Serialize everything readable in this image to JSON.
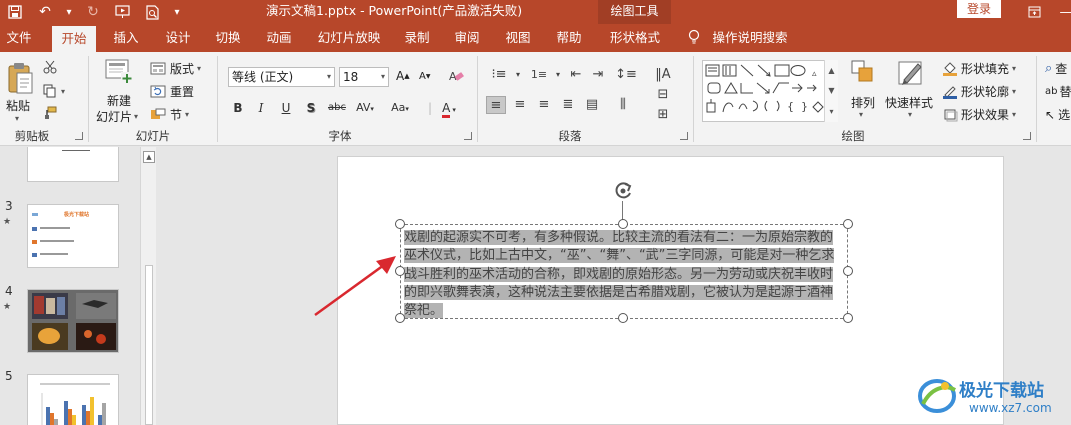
{
  "title_bar": {
    "doc_title": "演示文稿1.pptx  -  PowerPoint(产品激活失败)",
    "context_group": "绘图工具",
    "login": "登录"
  },
  "tabs": [
    "文件",
    "开始",
    "插入",
    "设计",
    "切换",
    "动画",
    "幻灯片放映",
    "录制",
    "审阅",
    "视图",
    "帮助",
    "形状格式",
    "操作说明搜索"
  ],
  "active_tab": "开始",
  "ribbon": {
    "clipboard": {
      "paste": "粘贴",
      "label": "剪贴板"
    },
    "slides": {
      "new_slide": "新建\n幻灯片",
      "layout": "版式",
      "reset": "重置",
      "section": "节",
      "label": "幻灯片"
    },
    "font": {
      "font_name": "等线 (正文)",
      "font_size": "18",
      "label": "字体"
    },
    "paragraph": {
      "label": "段落"
    },
    "drawing": {
      "arrange": "排列",
      "quick_styles": "快速样式",
      "shape_fill": "形状填充",
      "shape_outline": "形状轮廓",
      "shape_effects": "形状效果",
      "label": "绘图"
    },
    "editing": {
      "find": "查",
      "replace": "替",
      "select": "选"
    }
  },
  "slides_pane": {
    "slide_numbers": [
      "3",
      "4",
      "5"
    ],
    "slide3_title": "极光下载站"
  },
  "textbox": {
    "text": "戏剧的起源实不可考，有多种假说。比较主流的看法有二：一为原始宗教的巫术仪式，比如上古中文，“巫”、“舞”、“武”三字同源，可能是对一种乞求战斗胜利的巫术活动的合称，即戏剧的原始形态。另一为劳动或庆祝丰收时的即兴歌舞表演，这种说法主要依据是古希腊戏剧，它被认为是起源于酒神祭祀。"
  },
  "watermark": {
    "name": "极光下载站",
    "url": "www.xz7.com"
  },
  "colors": {
    "accent": "#b7472a",
    "active_tab_bg": "#f3f3f3",
    "arrow": "#d9282f"
  }
}
